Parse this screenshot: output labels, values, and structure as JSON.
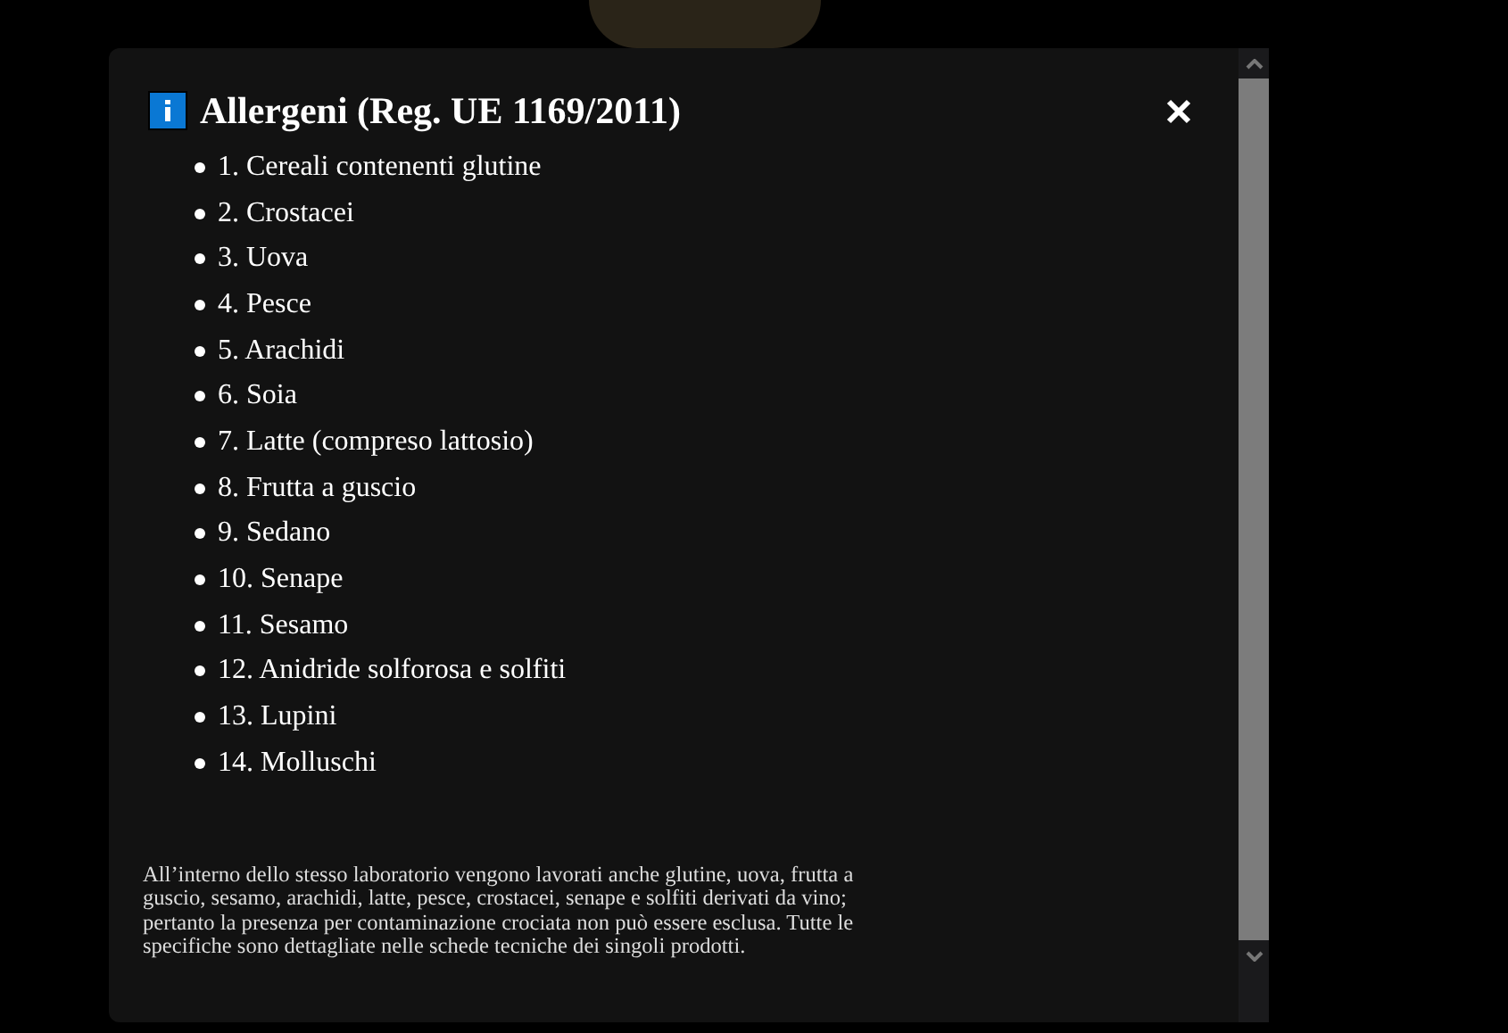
{
  "dialog": {
    "title": "Allergeni (Reg. UE 1169/2011)",
    "items": [
      "1. Cereali contenenti glutine",
      "2. Crostacei",
      "3. Uova",
      "4. Pesce",
      "5. Arachidi",
      "6. Soia",
      "7. Latte (compreso lattosio)",
      "8. Frutta a guscio",
      "9. Sedano",
      "10. Senape",
      "11. Sesamo",
      "12. Anidride solforosa e solfiti",
      "13. Lupini",
      "14. Molluschi"
    ],
    "note": "All’interno dello stesso laboratorio vengono lavorati anche glutine, uova, frutta a guscio, sesamo, arachidi, latte, pesce, crostacei, senape e solfiti derivati da vino; pertanto la presenza per contaminazione crociata non può essere esclusa. Tutte le specifiche sono dettagliate nelle schede tecniche dei singoli prodotti."
  }
}
